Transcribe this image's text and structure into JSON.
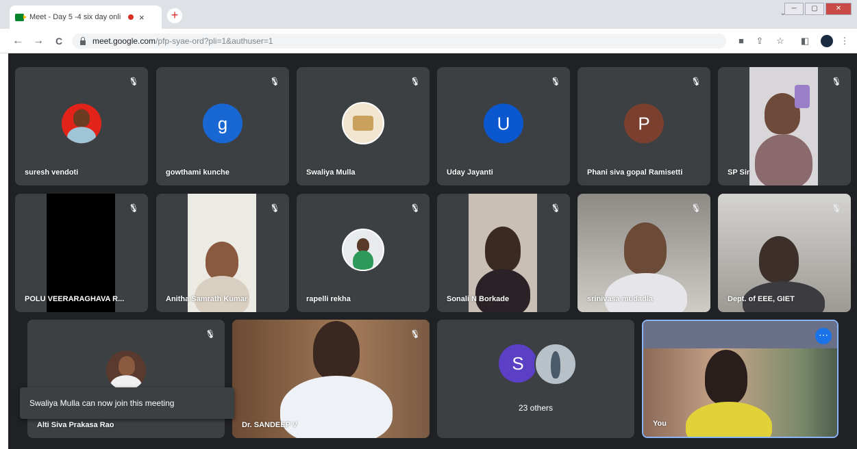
{
  "browser": {
    "tab_title": "Meet - Day 5 -4 six day onli",
    "tab_close": "×",
    "new_tab": "+",
    "tab_search": "⌄",
    "window_controls": [
      "─",
      "▢",
      "✕"
    ],
    "nav": {
      "back": "←",
      "forward": "→",
      "reload": "C"
    },
    "url_domain": "meet.google.com",
    "url_path": "/pfp-syae-ord?pli=1&authuser=1",
    "toolbar_icons": [
      "■",
      "⇪",
      "☆",
      "◧",
      "⋮"
    ]
  },
  "meet": {
    "mute_icon": "🎙",
    "participants": [
      {
        "name": "suresh vendoti",
        "type": "photo-avatar"
      },
      {
        "name": "gowthami kunche",
        "type": "letter",
        "letter": "g",
        "color": "#1967d2"
      },
      {
        "name": "Swaliya Mulla",
        "type": "photo-avatar"
      },
      {
        "name": "Uday Jayanti",
        "type": "letter",
        "letter": "U",
        "color": "#0b57d0"
      },
      {
        "name": "Phani siva gopal Ramisetti",
        "type": "letter",
        "letter": "P",
        "color": "#7a3f2f"
      },
      {
        "name": "SP Sir",
        "type": "video"
      },
      {
        "name": "POLU VEERARAGHAVA R...",
        "type": "video"
      },
      {
        "name": "Anitha Samrath Kumar",
        "type": "video"
      },
      {
        "name": "rapelli rekha",
        "type": "photo-avatar"
      },
      {
        "name": "Sonali N Borkade",
        "type": "video"
      },
      {
        "name": "srinivasa mudadla",
        "type": "video"
      },
      {
        "name": "Dept. of EEE, GIET",
        "type": "video"
      },
      {
        "name": "Alti Siva Prakasa Rao",
        "type": "photo-avatar"
      },
      {
        "name": "Dr. SANDEEP V",
        "type": "video"
      },
      {
        "name": "You",
        "type": "video"
      }
    ],
    "others": {
      "letter": "S",
      "label": "23 others",
      "color": "#5b3fc4"
    },
    "self_more": "⋯",
    "toast": "Swaliya Mulla can now join this meeting"
  }
}
